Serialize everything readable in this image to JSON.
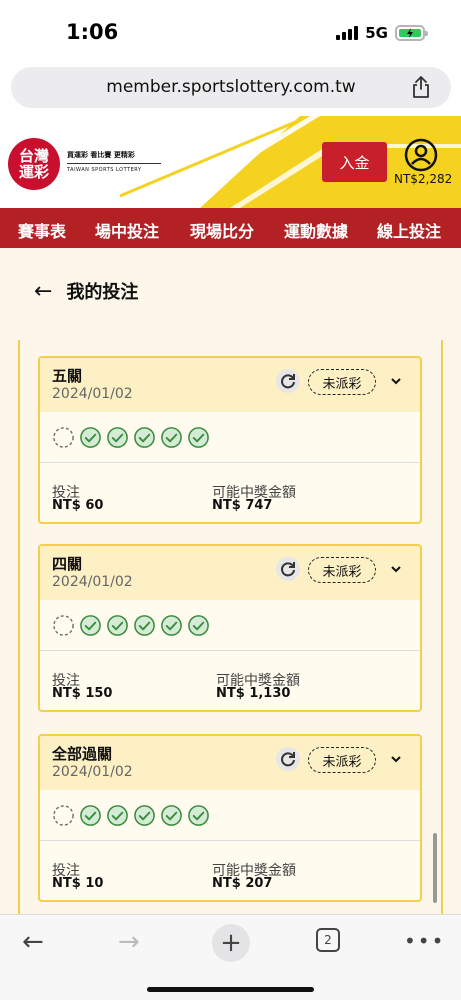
{
  "status_bar": {
    "time": "1:06",
    "network": "5G"
  },
  "browser": {
    "url": "member.sportslottery.com.tw",
    "tab_count": "2"
  },
  "site": {
    "logo_line1": "台灣",
    "logo_line2": "運彩",
    "slogan": "買運彩 看比賽 更精彩",
    "slogan_en": "TAIWAN SPORTS LOTTERY",
    "deposit_label": "入金",
    "balance": "NT$2,282"
  },
  "nav": {
    "items": [
      {
        "label": "賽事表"
      },
      {
        "label": "場中投注"
      },
      {
        "label": "現場比分"
      },
      {
        "label": "運動數據"
      },
      {
        "label": "線上投注"
      }
    ]
  },
  "page": {
    "title": "我的投注"
  },
  "bets": [
    {
      "title": "五關",
      "date": "2024/01/02",
      "status": "未派彩",
      "stake_label": "投注",
      "stake": "NT$ 60",
      "payout_label": "可能中獎金額",
      "payout": "NT$ 747",
      "legs": [
        "pending",
        "won",
        "won",
        "won",
        "won",
        "won"
      ]
    },
    {
      "title": "四關",
      "date": "2024/01/02",
      "status": "未派彩",
      "stake_label": "投注",
      "stake": "NT$ 150",
      "payout_label": "可能中獎金額",
      "payout": "NT$ 1,130",
      "legs": [
        "pending",
        "won",
        "won",
        "won",
        "won",
        "won"
      ]
    },
    {
      "title": "全部過關",
      "date": "2024/01/02",
      "status": "未派彩",
      "stake_label": "投注",
      "stake": "NT$ 10",
      "payout_label": "可能中獎金額",
      "payout": "NT$ 207",
      "legs": [
        "pending",
        "won",
        "won",
        "won",
        "won",
        "won"
      ]
    }
  ],
  "colors": {
    "brand_red": "#b32125",
    "deposit_red": "#c8202a",
    "accent_yellow": "#f3cf4a",
    "card_head": "#fdf0c4",
    "check_green": "#4caf50"
  },
  "icons": {
    "back": "arrow-left-icon",
    "share": "share-icon",
    "refresh": "refresh-icon",
    "expand": "chevron-down-icon",
    "user": "user-circle-icon",
    "leg_won": "check-circle-icon",
    "leg_pending": "dashed-circle-icon"
  }
}
